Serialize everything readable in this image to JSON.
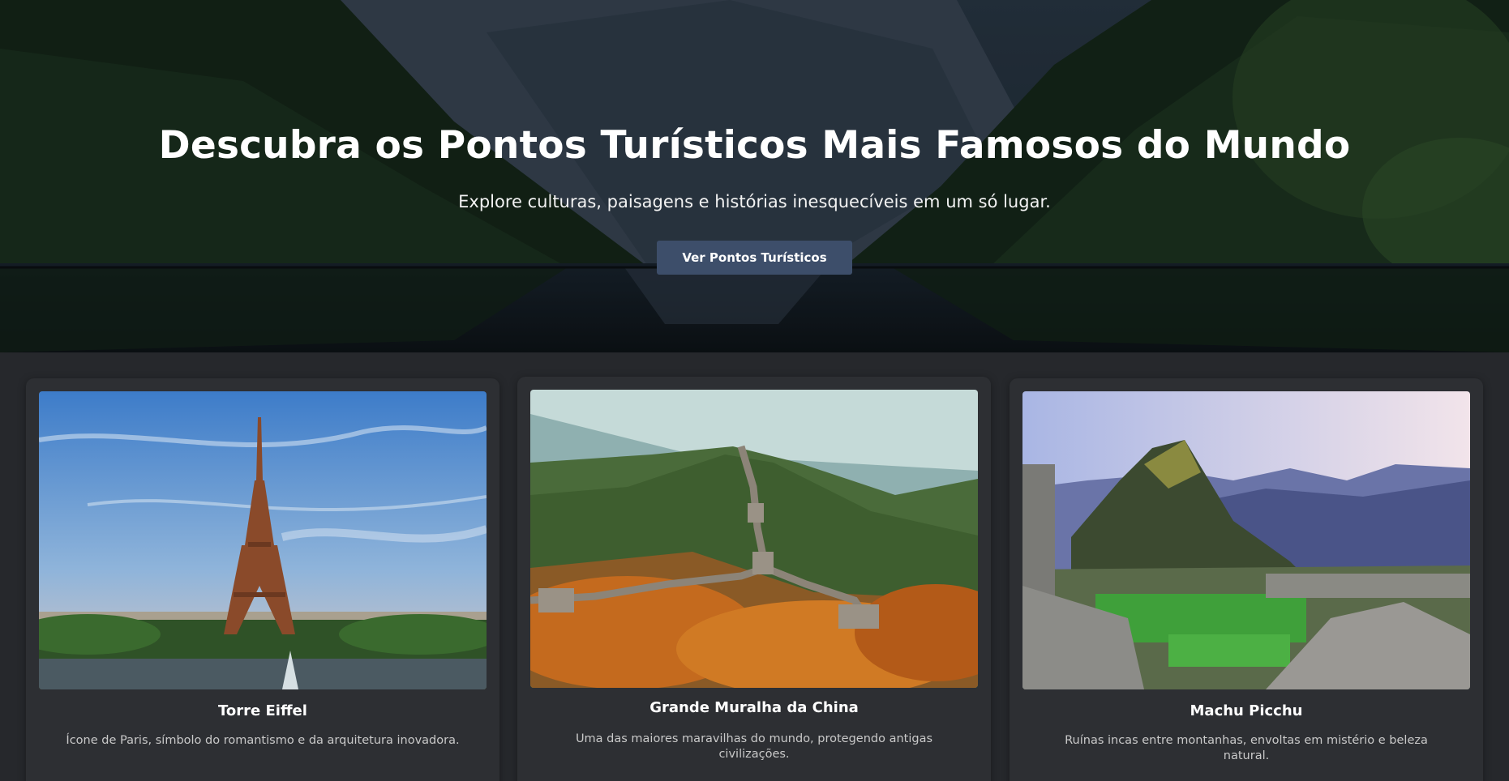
{
  "hero": {
    "title": "Descubra os Pontos Turísticos Mais Famosos do Mundo",
    "subtitle": "Explore culturas, paisagens e histórias inesquecíveis em um só lugar.",
    "button_label": "Ver Pontos Turísticos"
  },
  "colors": {
    "page_bg": "#26282c",
    "card_bg": "#2d2f33",
    "button_bg": "#3d4e6a",
    "desc_text": "#c9c9c9"
  },
  "cards": [
    {
      "title": "Torre Eiffel",
      "description": "Ícone de Paris, símbolo do romantismo e da arquitetura inovadora.",
      "image_icon": "eiffel-tower-photo"
    },
    {
      "title": "Grande Muralha da China",
      "description": "Uma das maiores maravilhas do mundo, protegendo antigas civilizações.",
      "image_icon": "great-wall-photo"
    },
    {
      "title": "Machu Picchu",
      "description": "Ruínas incas entre montanhas, envoltas em mistério e beleza natural.",
      "image_icon": "machu-picchu-photo"
    }
  ]
}
